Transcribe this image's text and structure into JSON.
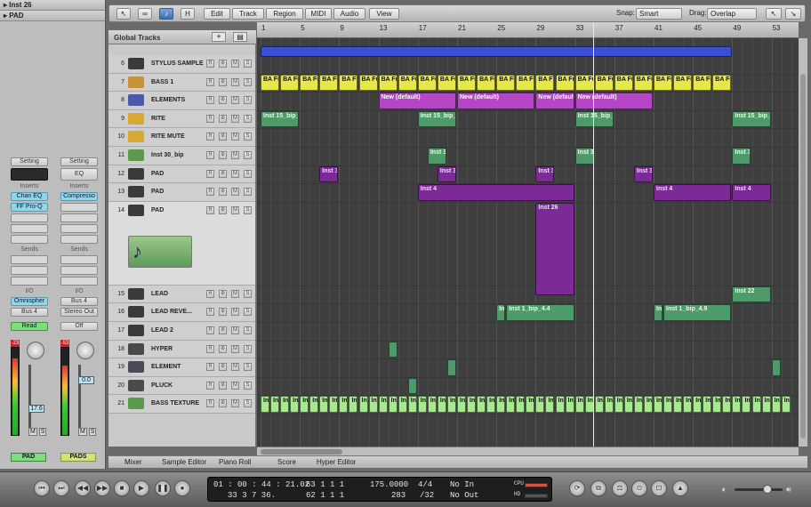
{
  "inspector": {
    "region_title": "Inst 26",
    "track_title": "PAD",
    "strip1": {
      "setting": "Setting",
      "inserts_label": "Inserts",
      "insert1": "Chan EQ",
      "insert2": "FF Pro-Q",
      "sends_label": "Sends",
      "io_label": "I/O",
      "input": "Omnispher",
      "output": "Bus 4",
      "automation": "Read",
      "meter_peak": "-23",
      "fader_value": "17.6",
      "m": "M",
      "s": "S",
      "name": "PAD"
    },
    "strip2": {
      "setting": "Setting",
      "eq": "EQ",
      "inserts_label": "Inserts",
      "insert1": "Compresso",
      "sends_label": "Sends",
      "io_label": "I/O",
      "input": "Bus 4",
      "output": "Stereo Out",
      "automation": "Off",
      "meter_peak": "-53",
      "fader_value": "0.0",
      "m": "M",
      "s": "S",
      "name": "PADS"
    }
  },
  "toolbar": {
    "h": "H",
    "menus": [
      "Edit",
      "Track",
      "Region",
      "MIDI",
      "Audio",
      "View"
    ],
    "snap_label": "Snap:",
    "snap_value": "Smart",
    "drag_label": "Drag:",
    "drag_value": "Overlap"
  },
  "global_tracks": "Global Tracks",
  "ruler": [
    "1",
    "5",
    "9",
    "13",
    "17",
    "21",
    "25",
    "29",
    "33",
    "37",
    "41",
    "45",
    "49",
    "53"
  ],
  "tracks": [
    {
      "num": "6",
      "name": "STYLUS SAMPLE",
      "icon": "#3a3a3a"
    },
    {
      "num": "7",
      "name": "BASS 1",
      "icon": "#c8923a"
    },
    {
      "num": "8",
      "name": "ELEMENTS",
      "icon": "#4a5aa8"
    },
    {
      "num": "9",
      "name": "RITE",
      "icon": "#d8a830"
    },
    {
      "num": "10",
      "name": "RITE MUTE",
      "icon": "#d8a830"
    },
    {
      "num": "11",
      "name": "Inst 30_bip",
      "icon": "#5a9a4a"
    },
    {
      "num": "12",
      "name": "PAD",
      "icon": "#3a3a3a"
    },
    {
      "num": "13",
      "name": "PAD",
      "icon": "#3a3a3a"
    },
    {
      "num": "14",
      "name": "PAD",
      "icon": "#3a3a3a"
    },
    {
      "num": "15",
      "name": "LEAD",
      "icon": "#3a3a3a"
    },
    {
      "num": "16",
      "name": "LEAD REVE...",
      "icon": "#3a3a3a"
    },
    {
      "num": "17",
      "name": "LEAD 2",
      "icon": "#3a3a3a"
    },
    {
      "num": "18",
      "name": "HYPER",
      "icon": "#4a4a4a"
    },
    {
      "num": "19",
      "name": "ELEMENT",
      "icon": "#4a4a5a"
    },
    {
      "num": "20",
      "name": "PLUCK",
      "icon": "#4a4a4a"
    },
    {
      "num": "21",
      "name": "BASS TEXTURE",
      "icon": "#5a9a4a"
    }
  ],
  "track_buttons": {
    "mute": "M",
    "solo": "S",
    "rec": "R"
  },
  "regions": {
    "bass_label": "BA Fu",
    "new_default": "New (default)",
    "inst15a": "Inst 15_bip_2",
    "inst15b": "Inst 15_bip_2.1",
    "inst15c": "Inst 15_bip_2.2",
    "inst15d": "Inst 15_bip_2.3",
    "inst30a": "Inst 30_l",
    "inst30b": "Inst 30_l",
    "inst30c": "Inst 30_l",
    "inst3a": "Inst 3",
    "inst3b": "Inst 3",
    "inst35a": "Inst 35",
    "inst35b": "Inst 35",
    "inst4a": "Inst 4",
    "inst4b": "Inst 4",
    "inst4c": "Inst 4",
    "inst26": "Inst 26",
    "inst22": "Inst 22",
    "inst1a": "Inst 1_bip_4.4",
    "inst1b": "Inst 1_bip_4.9",
    "ins_short": "Ins",
    "tex_label": "In"
  },
  "tabs": [
    "Mixer",
    "Sample Editor",
    "Piano Roll",
    "Score",
    "Hyper Editor"
  ],
  "transport": {
    "time": "01 : 00 : 44 : 21.02",
    "time2": "33    3    7   36.",
    "bars": "62    1    1      1",
    "bars2": "63    1    1      1",
    "tempo": "175.0000",
    "tempo2": "283",
    "sig": "4/4",
    "div": "/32",
    "in": "No In",
    "out": "No Out",
    "cpu": "CPU",
    "hd": "HD"
  }
}
